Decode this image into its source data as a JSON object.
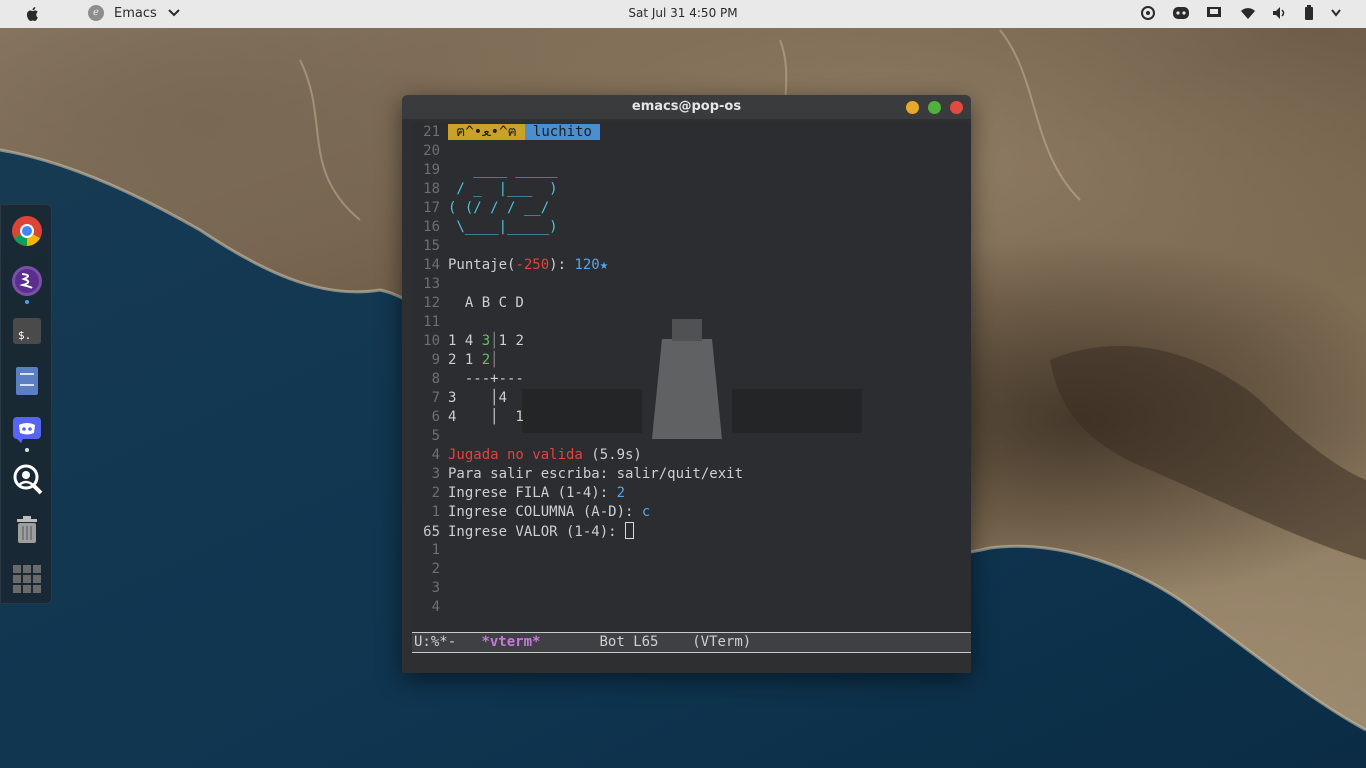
{
  "topbar": {
    "app_name": "Emacs",
    "clock": "Sat Jul 31   4:50 PM",
    "tray_icons": [
      "settings-icon",
      "discord-icon",
      "display-icon",
      "wifi-icon",
      "volume-icon",
      "battery-icon"
    ]
  },
  "dock": {
    "items": [
      "chrome-icon",
      "emacs-icon",
      "terminal-icon",
      "files-icon",
      "discord-icon",
      "search-app-icon",
      "trash-icon",
      "apps-grid-icon"
    ]
  },
  "window": {
    "title": "emacs@pop-os",
    "header_tag_1": "ฅ^•ﻌ•^ฅ",
    "header_tag_2": "luchito",
    "lines": [
      {
        "n": "21"
      },
      {
        "n": "20",
        "text": ""
      },
      {
        "n": "19",
        "text": "   ____ _____"
      },
      {
        "n": "18",
        "text": " / _  |___  )"
      },
      {
        "n": "17",
        "text": "( (/ / / __/"
      },
      {
        "n": "16",
        "text": " \\____|_____)"
      },
      {
        "n": "15",
        "text": ""
      },
      {
        "n": "14",
        "score_label": "Puntaje(",
        "score_penalty": "-250",
        "score_mid": "): ",
        "score_value": "120★"
      },
      {
        "n": "13",
        "text": ""
      },
      {
        "n": "12",
        "text": "  A B C D"
      },
      {
        "n": "11",
        "text": ""
      },
      {
        "n": "10",
        "a": "1 4 ",
        "b": "3",
        "c": "│",
        "d": "1 2"
      },
      {
        "n": "9",
        "a": "2 1 ",
        "b": "2",
        "c": "│",
        "d": ""
      },
      {
        "n": "8",
        "text": "  ---+---"
      },
      {
        "n": "7",
        "text": "3    │4"
      },
      {
        "n": "6",
        "text": "4    │  1"
      },
      {
        "n": "5",
        "text": ""
      },
      {
        "n": "4",
        "err": "Jugada no valida",
        "rest": " (5.9s)"
      },
      {
        "n": "3",
        "text": "Para salir escriba: salir/quit/exit"
      },
      {
        "n": "2",
        "label": "Ingrese FILA (1-4): ",
        "value": "2"
      },
      {
        "n": "1",
        "label": "Ingrese COLUMNA (A-D): ",
        "value": "c"
      },
      {
        "n": "65",
        "label": "Ingrese VALOR (1-4): "
      },
      {
        "n": "1",
        "text": ""
      },
      {
        "n": "2",
        "text": ""
      },
      {
        "n": "3",
        "text": ""
      },
      {
        "n": "4",
        "text": ""
      }
    ],
    "modeline": {
      "state": "U:%*-",
      "buffer": "*vterm*",
      "position": "Bot L65",
      "mode": "(VTerm)"
    }
  },
  "colors": {
    "accent_red": "#e0443e",
    "accent_blue": "#56a6e8",
    "accent_green": "#5fc35f",
    "ascii_cyan": "#4fc3d9",
    "buffer_purple": "#c678dd"
  }
}
